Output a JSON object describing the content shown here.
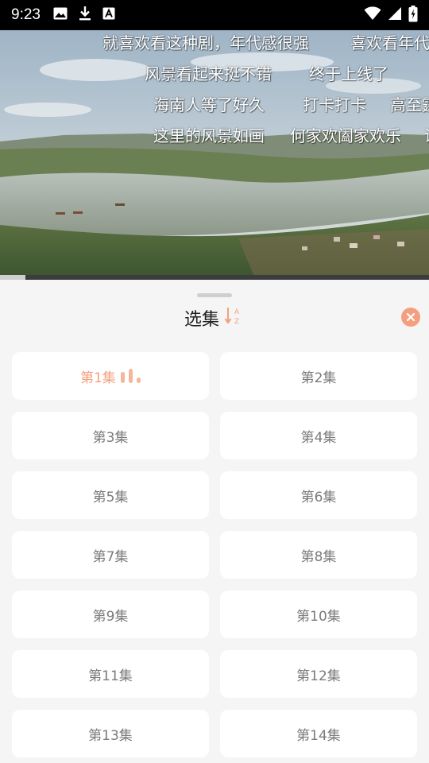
{
  "status_bar": {
    "time": "9:23",
    "left_icons": [
      "image-icon",
      "download-icon",
      "font-icon"
    ],
    "right_icons": [
      "wifi-icon",
      "signal-icon",
      "battery-icon"
    ]
  },
  "video": {
    "progress_fraction": 0.06,
    "danmaku": [
      "就喜欢看这种剧，年代感很强",
      "喜欢看年代",
      "风景看起来挺不错",
      "终于上线了",
      "海南人等了好久",
      "打卡打卡",
      "高至霆",
      "这里的风景如画",
      "何家欢阖家欢乐",
      "说"
    ]
  },
  "sheet": {
    "title": "选集",
    "sort_icon": "sort-az-icon",
    "close_icon": "close-icon",
    "accent_color": "#f4a07e",
    "episodes": [
      "第1集",
      "第2集",
      "第3集",
      "第4集",
      "第5集",
      "第6集",
      "第7集",
      "第8集",
      "第9集",
      "第10集",
      "第11集",
      "第12集",
      "第13集",
      "第14集"
    ],
    "active_episode_index": 0
  }
}
